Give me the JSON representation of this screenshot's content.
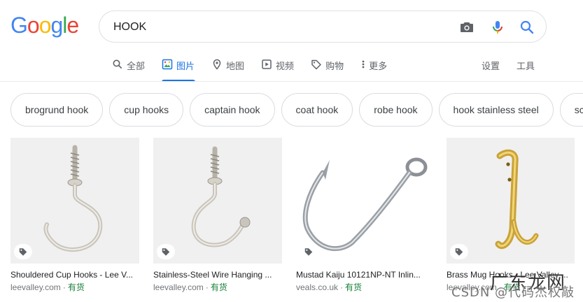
{
  "logo": {
    "letters": [
      "G",
      "o",
      "o",
      "g",
      "l",
      "e"
    ],
    "colors": [
      "#4285F4",
      "#EA4335",
      "#FBBC05",
      "#4285F4",
      "#34A853",
      "#EA4335"
    ]
  },
  "search": {
    "query": "HOOK",
    "camera_icon": "camera-icon",
    "mic_icon": "mic-icon",
    "search_icon": "search-icon"
  },
  "tabs": [
    {
      "label": "全部",
      "icon": "search-icon",
      "active": false
    },
    {
      "label": "图片",
      "icon": "image-icon",
      "active": true
    },
    {
      "label": "地图",
      "icon": "map-pin-icon",
      "active": false
    },
    {
      "label": "视频",
      "icon": "play-icon",
      "active": false
    },
    {
      "label": "购物",
      "icon": "tag-icon",
      "active": false
    },
    {
      "label": "更多",
      "icon": "more-vert-icon",
      "active": false
    }
  ],
  "tools": {
    "settings": "设置",
    "tools": "工具"
  },
  "chips": [
    "brogrund hook",
    "cup hooks",
    "captain hook",
    "coat hook",
    "robe hook",
    "hook stainless steel",
    "sc"
  ],
  "results": [
    {
      "title": "Shouldered Cup Hooks - Lee V...",
      "source": "leevalley.com",
      "sep": "·",
      "stock": "有货"
    },
    {
      "title": "Stainless-Steel Wire Hanging ...",
      "source": "leevalley.com",
      "sep": "·",
      "stock": "有货"
    },
    {
      "title": "Mustad Kaiju 10121NP-NT Inlin...",
      "source": "veals.co.uk",
      "sep": "·",
      "stock": "有货"
    },
    {
      "title": "Brass Mug Hooks - Lee Valley ...",
      "source": "leevalley.com",
      "sep": "·",
      "stock": "有货"
    }
  ],
  "watermark": "CSDN @代码杰权敲",
  "watermark_overlay": "广东龙网",
  "colors": {
    "accent": "#1a73e8",
    "stock_green": "#188038"
  }
}
